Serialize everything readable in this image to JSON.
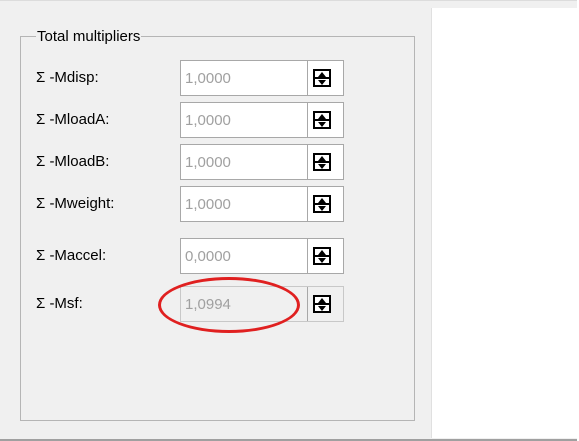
{
  "group": {
    "title": "Total multipliers"
  },
  "rows": [
    {
      "label": "Σ -Mdisp:",
      "value": "1,0000"
    },
    {
      "label": "Σ -MloadA:",
      "value": "1,0000"
    },
    {
      "label": "Σ -MloadB:",
      "value": "1,0000"
    },
    {
      "label": "Σ -Mweight:",
      "value": "1,0000"
    },
    {
      "label": "Σ -Maccel:",
      "value": "0,0000"
    },
    {
      "label": "Σ -Msf:",
      "value": "1,0994"
    }
  ],
  "colors": {
    "highlight": "#e02020",
    "disabled_text": "#a0a0a0"
  }
}
